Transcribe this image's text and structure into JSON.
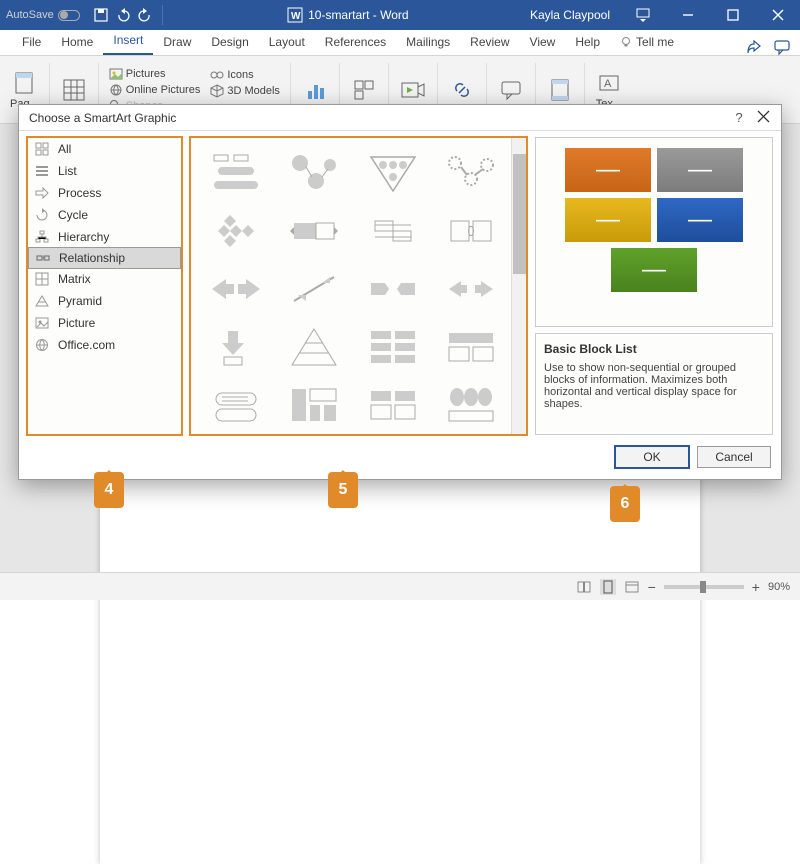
{
  "titlebar": {
    "autosave_label": "AutoSave",
    "autosave_state": "Off",
    "doc_name": "10-smartart - Word",
    "user_name": "Kayla Claypool"
  },
  "tabs": {
    "file": "File",
    "home": "Home",
    "insert": "Insert",
    "draw": "Draw",
    "design": "Design",
    "layout": "Layout",
    "references": "References",
    "mailings": "Mailings",
    "review": "Review",
    "view": "View",
    "help": "Help",
    "tellme": "Tell me"
  },
  "ribbon": {
    "pages_label": "Pag...",
    "pictures": "Pictures",
    "online_pictures": "Online Pictures",
    "shapes": "Shapes",
    "icons": "Icons",
    "models": "3D Models",
    "text_group": "Tex..."
  },
  "dialog": {
    "title": "Choose a SmartArt Graphic",
    "categories": [
      "All",
      "List",
      "Process",
      "Cycle",
      "Hierarchy",
      "Relationship",
      "Matrix",
      "Pyramid",
      "Picture",
      "Office.com"
    ],
    "selected_category": "Relationship",
    "preview": {
      "name": "Basic Block List",
      "description": "Use to show non-sequential or grouped blocks of information. Maximizes both horizontal and vertical display space for shapes."
    },
    "ok": "OK",
    "cancel": "Cancel"
  },
  "callouts": {
    "c4": "4",
    "c5": "5",
    "c6": "6"
  },
  "status": {
    "zoom": "90%"
  },
  "colors": {
    "accent": "#2b579a",
    "highlight": "#e08a2a"
  }
}
